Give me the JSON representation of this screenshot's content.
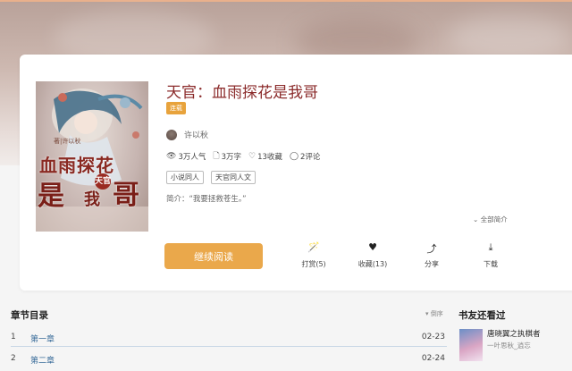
{
  "book": {
    "title": "天官：血雨探花是我哥",
    "status": "连载",
    "author": "许以秋",
    "stats": {
      "popularity": "3万人气",
      "words": "3万字",
      "favorites": "13收藏",
      "comments": "2评论"
    },
    "tags": [
      "小说同人",
      "天官同人文"
    ],
    "intro": "简介：“我要拯救苍生。”",
    "full_intro_label": "全部简介",
    "cover": {
      "author_line": "著|许以秋",
      "title_part1": "血雨探花",
      "title_part2": "是",
      "title_badge": "天官",
      "title_part3": "我",
      "title_part4": "哥"
    }
  },
  "actions": {
    "read_label": "继续阅读",
    "reward_label": "打赏(5)",
    "favorite_label": "收藏(13)",
    "share_label": "分享",
    "download_label": "下载",
    "reward_icon": "magic-wand-icon",
    "favorite_icon": "heart-icon",
    "share_icon": "share-icon",
    "download_icon": "download-icon"
  },
  "toc": {
    "title": "章节目录",
    "sort_label": "倒序",
    "chapters": [
      {
        "num": "1",
        "name": "第一章",
        "date": "02-23"
      },
      {
        "num": "2",
        "name": "第二章",
        "date": "02-24"
      }
    ]
  },
  "also_read": {
    "title": "书友还看过",
    "book_title": "唐晓翼之执棋者",
    "book_author": "一叶思秋_逍忘"
  },
  "colors": {
    "accent": "#eaa84b",
    "title": "#8b2b2b",
    "badge": "#e8a33c",
    "link": "#3a6d9a"
  }
}
